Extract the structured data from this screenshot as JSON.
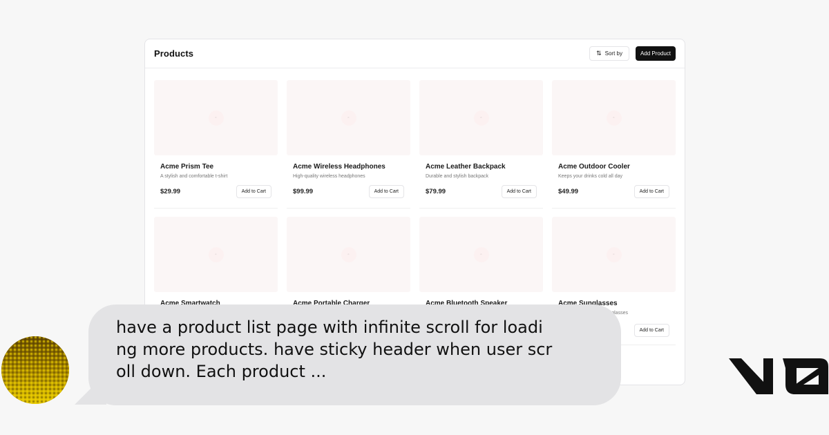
{
  "header": {
    "title": "Products",
    "sort_label": "Sort by",
    "add_label": "Add Product"
  },
  "products": [
    {
      "name": "Acme Prism Tee",
      "description": "A stylish and comfortable t-shirt",
      "price": "$29.99",
      "cart_label": "Add to Cart"
    },
    {
      "name": "Acme Wireless Headphones",
      "description": "High-quality wireless headphones",
      "price": "$99.99",
      "cart_label": "Add to Cart"
    },
    {
      "name": "Acme Leather Backpack",
      "description": "Durable and stylish backpack",
      "price": "$79.99",
      "cart_label": "Add to Cart"
    },
    {
      "name": "Acme Outdoor Cooler",
      "description": "Keeps your drinks cold all day",
      "price": "$49.99",
      "cart_label": "Add to Cart"
    },
    {
      "name": "Acme Smartwatch",
      "description": "",
      "price": "",
      "cart_label": ""
    },
    {
      "name": "Acme Portable Charger",
      "description": "",
      "price": "",
      "cart_label": ""
    },
    {
      "name": "Acme Bluetooth Speaker",
      "description": "",
      "price": "",
      "cart_label": ""
    },
    {
      "name": "Acme Sunglasses",
      "description": "sunglasses",
      "price": "",
      "cart_label": "Add to Cart"
    }
  ],
  "image_placeholder_glyph": "▫",
  "chat": {
    "message": "have a product list page with infinite scroll for loadi\nng more products. have sticky header when user scr\noll down. Each product ..."
  },
  "icons": {
    "sort": "sort-arrows-icon",
    "avatar": "pixel-gradient-avatar",
    "logo": "v0-logo"
  },
  "colors": {
    "page_bg": "#f7f7f7",
    "bubble_bg": "#e3e3e5",
    "primary_button": "#111111",
    "image_bg": "#fbf6f6",
    "avatar_gold": "#d4b400"
  }
}
